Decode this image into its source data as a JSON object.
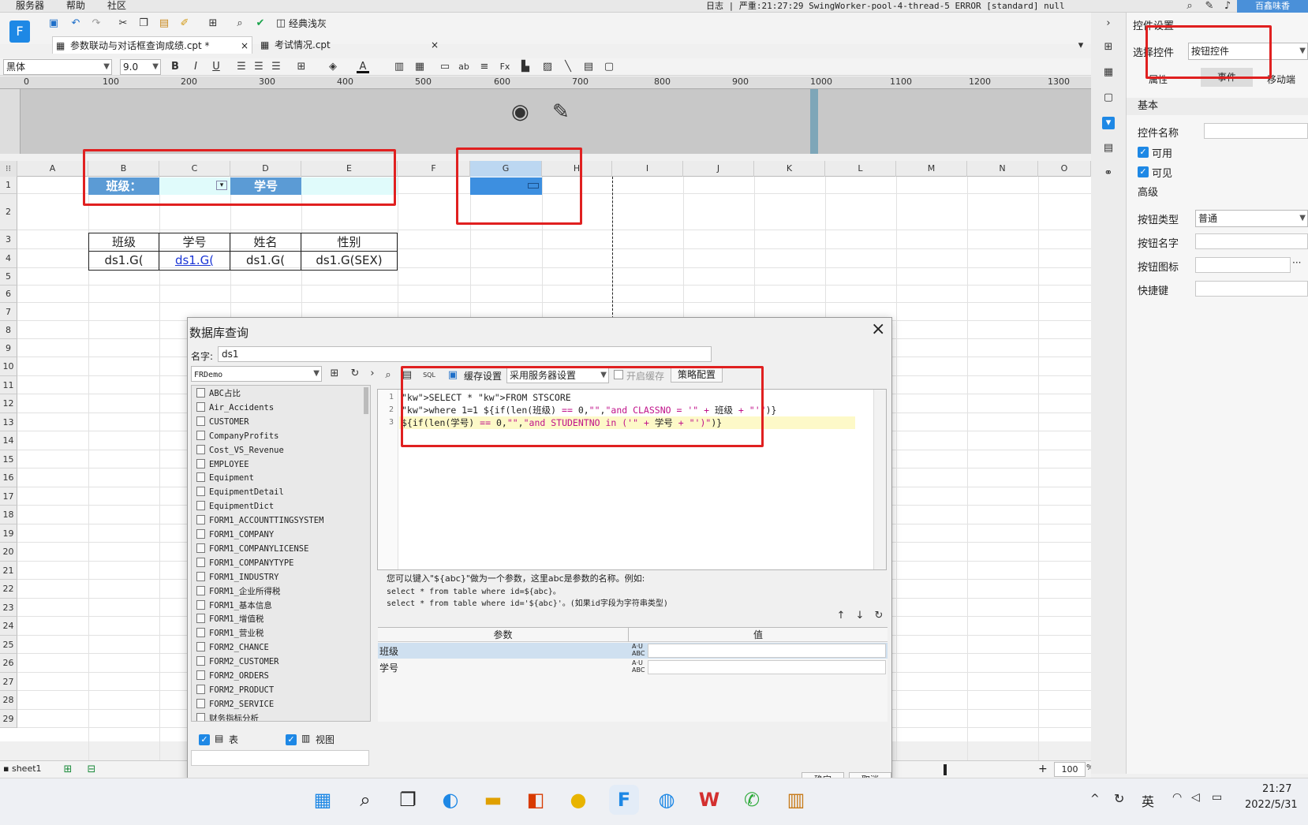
{
  "menu": {
    "items": [
      "服务器",
      "帮助",
      "社区"
    ],
    "log": "日志 | 严重:21:27:29 SwingWorker-pool-4-thread-5 ERROR [standard] null",
    "account": "百鑫味香"
  },
  "toolbar": {
    "theme_label": "经典浅灰"
  },
  "tabs": [
    {
      "label": "参数联动与对话框查询成绩.cpt *"
    },
    {
      "label": "考试情况.cpt"
    }
  ],
  "format": {
    "font": "黑体",
    "size": "9.0"
  },
  "ruler": {
    "ticks": [
      "0",
      "100",
      "200",
      "300",
      "400",
      "500",
      "600",
      "700",
      "800",
      "900",
      "1000",
      "1100",
      "1200",
      "1300"
    ]
  },
  "grid": {
    "columns": [
      "A",
      "B",
      "C",
      "D",
      "E",
      "F",
      "G",
      "H",
      "I",
      "J",
      "K",
      "L",
      "M",
      "N",
      "O"
    ],
    "rows": [
      "1",
      "2",
      "3",
      "4",
      "5",
      "6",
      "7",
      "8",
      "9",
      "10",
      "11",
      "12",
      "13",
      "14",
      "15",
      "16",
      "17",
      "18",
      "19",
      "20",
      "21",
      "22",
      "23",
      "24",
      "25",
      "26",
      "27",
      "28",
      "29"
    ],
    "cells": {
      "b1": "班级：",
      "d1": "学号",
      "b3": "班级",
      "c3": "学号",
      "d3": "姓名",
      "e3": "性别",
      "b4": "ds1.G(",
      "c4": "ds1.G(",
      "d4": "ds1.G(",
      "e4": "ds1.G(SEX)"
    }
  },
  "sheet": {
    "tab": "sheet1",
    "zoom": "100",
    "zoom_unit": "%"
  },
  "panel": {
    "title": "控件设置",
    "select_label": "选择控件",
    "select_value": "按钮控件",
    "tabs": [
      "属性",
      "事件",
      "移动端"
    ],
    "basic": "基本",
    "name_label": "控件名称",
    "enabled": "可用",
    "visible": "可见",
    "advanced": "高级",
    "btn_type_label": "按钮类型",
    "btn_type_value": "普通",
    "btn_name_label": "按钮名字",
    "btn_icon_label": "按钮图标",
    "shortcut_label": "快捷键"
  },
  "dialog": {
    "title": "数据库查询",
    "name_label": "名字:",
    "name_value": "ds1",
    "connection": "FRDemo",
    "cache_label": "缓存设置",
    "cache_value": "采用服务器设置",
    "open_cache": "开启缓存",
    "strategy": "策略配置",
    "tables": [
      "ABC占比",
      "Air_Accidents",
      "CUSTOMER",
      "CompanyProfits",
      "Cost_VS_Revenue",
      "EMPLOYEE",
      "Equipment",
      "EquipmentDetail",
      "EquipmentDict",
      "FORM1_ACCOUNTTINGSYSTEM",
      "FORM1_COMPANY",
      "FORM1_COMPANYLICENSE",
      "FORM1_COMPANYTYPE",
      "FORM1_INDUSTRY",
      "FORM1_企业所得税",
      "FORM1_基本信息",
      "FORM1_增值税",
      "FORM1_营业税",
      "FORM2_CHANCE",
      "FORM2_CUSTOMER",
      "FORM2_ORDERS",
      "FORM2_PRODUCT",
      "FORM2_SERVICE",
      "财务指标分析"
    ],
    "table_chk": "表",
    "view_chk": "视图",
    "sql_lines": [
      {
        "n": "1",
        "t": "SELECT * FROM STSCORE"
      },
      {
        "n": "2",
        "t": "where 1=1 ${if(len(班级) == 0,\"\",\"and CLASSNO = '\" + 班级 + \"'\")}"
      },
      {
        "n": "3",
        "t": "${if(len(学号) == 0,\"\",\"and STUDENTNO in ('\" + 学号 + \"')\")}"
      }
    ],
    "hint": [
      "您可以键入\"${abc}\"做为一个参数，这里abc是参数的名称。例如:",
      "select * from table where id=${abc}。",
      "select * from table where id='${abc}'。(如果id字段为字符串类型)"
    ],
    "param_col": "参数",
    "value_col": "值",
    "params": [
      "班级",
      "学号"
    ],
    "ok": "确定",
    "cancel": "取消"
  },
  "taskbar": {
    "ime": "英",
    "time": "21:27",
    "date": "2022/5/31"
  },
  "colors": {
    "accent": "#1e88e5",
    "header_cell": "#5b9bd5",
    "highlight": "#e02020"
  }
}
